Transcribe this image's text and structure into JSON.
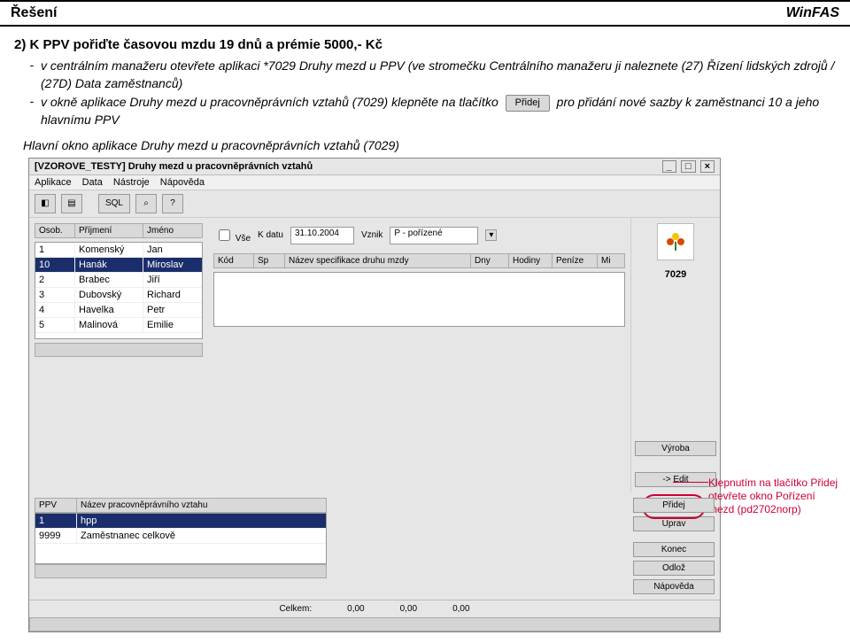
{
  "header": {
    "left": "Řešení",
    "right": "WinFAS"
  },
  "heading": "2) K PPV pořiďte časovou mzdu 19 dnů a prémie 5000,- Kč",
  "bullets": [
    "v centrálním manažeru otevřete aplikaci *7029 Druhy mezd u PPV (ve stromečku Centrálního manažeru ji naleznete (27) Řízení lidských zdrojů / (27D) Data zaměstnanců)",
    "v okně aplikace Druhy mezd u pracovněprávních vztahů (7029) klepněte na tlačítko",
    "pro přidání nové sazby k zaměstnanci 10 a jeho hlavnímu PPV"
  ],
  "btn_pridej_inline": "Přidej",
  "subhead": "Hlavní okno aplikace Druhy mezd u pracovněprávních vztahů (7029)",
  "window": {
    "title": "[VZOROVE_TESTY] Druhy mezd u pracovněprávních vztahů",
    "menu": [
      "Aplikace",
      "Data",
      "Nástroje",
      "Nápověda"
    ],
    "toolbar_sql": "SQL",
    "emp_columns": [
      "Osob.",
      "Příjmení",
      "Jméno"
    ],
    "employees": [
      {
        "id": "1",
        "last": "Komenský",
        "first": "Jan"
      },
      {
        "id": "10",
        "last": "Hanák",
        "first": "Miroslav"
      },
      {
        "id": "2",
        "last": "Brabec",
        "first": "Jiří"
      },
      {
        "id": "3",
        "last": "Dubovský",
        "first": "Richard"
      },
      {
        "id": "4",
        "last": "Havelka",
        "first": "Petr"
      },
      {
        "id": "5",
        "last": "Malinová",
        "first": "Emilie"
      }
    ],
    "filter": {
      "vse": "Vše",
      "k_datu": "K datu",
      "k_datu_val": "31.10.2004",
      "vznik": "Vznik",
      "vznik_val": "P - pořízené"
    },
    "spec_columns": [
      "Kód",
      "Sp",
      "Název specifikace druhu mzdy",
      "Dny",
      "Hodiny",
      "Peníze",
      "Mi"
    ],
    "right": {
      "code": "7029",
      "vyroba": "Výroba",
      "edit": "-> Edit"
    },
    "ppv_columns": [
      "PPV",
      "Název pracovněprávního vztahu"
    ],
    "ppv_rows": [
      {
        "id": "1",
        "name": "hpp"
      },
      {
        "id": "9999",
        "name": "Zaměstnanec celkově"
      }
    ],
    "ppv_buttons": [
      "Přidej",
      "Uprav",
      "Konec",
      "Odlož",
      "Nápověda"
    ],
    "footer": {
      "celkem": "Celkem:",
      "v1": "0,00",
      "v2": "0,00",
      "v3": "0,00"
    }
  },
  "callout": "Klepnutím na tlačítko Přidej otevřete okno Pořízení mezd (pd2702norp)"
}
